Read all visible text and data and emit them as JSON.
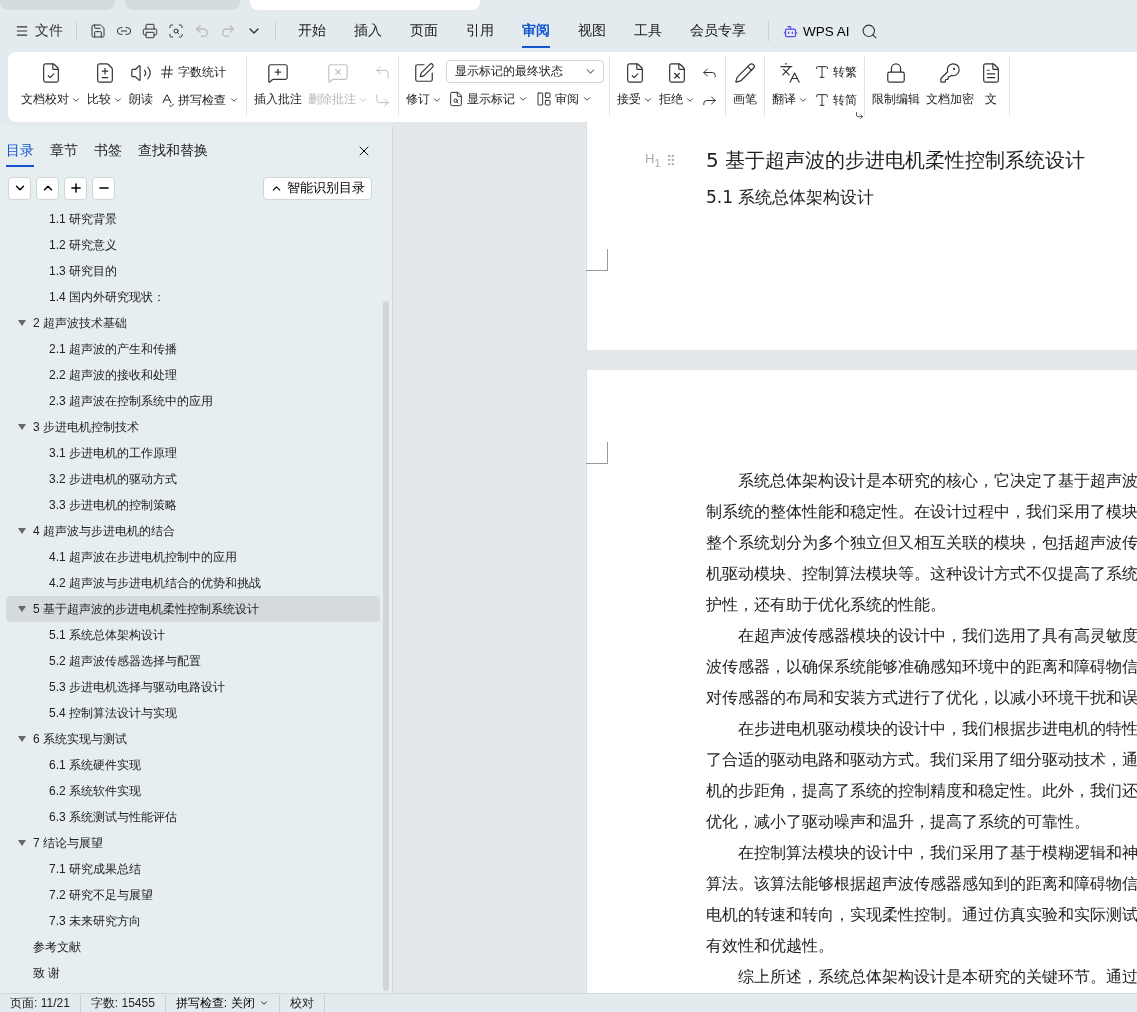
{
  "browser_tabs": [
    {
      "selected": false
    },
    {
      "selected": false
    },
    {
      "selected": true
    }
  ],
  "menu": {
    "file_label": "文件",
    "tabs": [
      {
        "label": "开始",
        "selected": false
      },
      {
        "label": "插入",
        "selected": false
      },
      {
        "label": "页面",
        "selected": false
      },
      {
        "label": "引用",
        "selected": false
      },
      {
        "label": "审阅",
        "selected": true
      },
      {
        "label": "视图",
        "selected": false
      },
      {
        "label": "工具",
        "selected": false
      },
      {
        "label": "会员专享",
        "selected": false
      }
    ],
    "ai_label": "WPS AI"
  },
  "ribbon": {
    "groups": [
      {
        "items": [
          {
            "kind": "large",
            "label": "文档校对",
            "caret": true,
            "disabled": false
          },
          {
            "kind": "large",
            "label": "比较",
            "caret": true,
            "disabled": false
          },
          {
            "kind": "large",
            "label": "朗读",
            "caret": false,
            "disabled": false
          },
          {
            "kind": "stack",
            "items": [
              {
                "kind": "small",
                "label": "字数统计",
                "caret": false,
                "disabled": false
              },
              {
                "kind": "small",
                "label": "拼写检查",
                "caret": true,
                "disabled": false
              }
            ]
          }
        ]
      },
      {
        "items": [
          {
            "kind": "large",
            "label": "插入批注",
            "caret": false,
            "disabled": false
          },
          {
            "kind": "large",
            "label": "删除批注",
            "caret": true,
            "disabled": true
          },
          {
            "kind": "stack",
            "items": [
              {
                "kind": "icon",
                "disabled": true
              },
              {
                "kind": "icon",
                "disabled": true
              }
            ]
          }
        ]
      },
      {
        "items": [
          {
            "kind": "large",
            "label": "修订",
            "caret": true,
            "disabled": false
          },
          {
            "kind": "stack",
            "items": [
              {
                "kind": "select",
                "value": "显示标记的最终状态"
              },
              {
                "kind": "row",
                "items": [
                  {
                    "kind": "small",
                    "label": "显示标记",
                    "caret": true,
                    "disabled": false
                  },
                  {
                    "kind": "small",
                    "label": "审阅",
                    "caret": true,
                    "disabled": false
                  }
                ]
              }
            ]
          }
        ]
      },
      {
        "items": [
          {
            "kind": "large",
            "label": "接受",
            "caret": true,
            "disabled": false
          },
          {
            "kind": "large",
            "label": "拒绝",
            "caret": true,
            "disabled": false
          },
          {
            "kind": "stack",
            "items": [
              {
                "kind": "icon",
                "disabled": false
              },
              {
                "kind": "icon",
                "disabled": false
              }
            ]
          }
        ]
      },
      {
        "items": [
          {
            "kind": "large",
            "label": "画笔",
            "caret": false,
            "disabled": false
          }
        ]
      },
      {
        "launcher": true,
        "items": [
          {
            "kind": "large",
            "label": "翻译",
            "caret": true,
            "disabled": false
          },
          {
            "kind": "stack",
            "items": [
              {
                "kind": "small",
                "label": "转繁",
                "caret": false,
                "disabled": false
              },
              {
                "kind": "small",
                "label": "转简",
                "caret": false,
                "disabled": false
              }
            ]
          }
        ]
      },
      {
        "items": [
          {
            "kind": "large",
            "label": "限制编辑",
            "caret": false,
            "disabled": false
          },
          {
            "kind": "large",
            "label": "文档加密",
            "caret": false,
            "disabled": false
          },
          {
            "kind": "large",
            "label": "文",
            "caret": false,
            "disabled": false
          }
        ]
      }
    ]
  },
  "nav_panel": {
    "tabs": [
      {
        "label": "目录",
        "selected": true
      },
      {
        "label": "章节",
        "selected": false
      },
      {
        "label": "书签",
        "selected": false
      },
      {
        "label": "查找和替换",
        "selected": false
      }
    ],
    "smart_button": "智能识别目录",
    "continued": [
      {
        "label": "1.1  研究背景",
        "selected": false
      },
      {
        "label": "1.2  研究意义",
        "selected": false
      },
      {
        "label": "1.3  研究目的",
        "selected": false
      },
      {
        "label": "1.4 国内外研究现状：",
        "selected": false
      }
    ],
    "items": [
      {
        "label": "2  超声波技术基础",
        "selected": false,
        "expanded": true,
        "children": [
          {
            "label": "2.1  超声波的产生和传播",
            "selected": false
          },
          {
            "label": "2.2  超声波的接收和处理",
            "selected": false
          },
          {
            "label": "2.3  超声波在控制系统中的应用",
            "selected": false
          }
        ]
      },
      {
        "label": "3  步进电机控制技术",
        "selected": false,
        "expanded": true,
        "children": [
          {
            "label": "3.1  步进电机的工作原理",
            "selected": false
          },
          {
            "label": "3.2  步进电机的驱动方式",
            "selected": false
          },
          {
            "label": "3.3  步进电机的控制策略",
            "selected": false
          }
        ]
      },
      {
        "label": "4  超声波与步进电机的结合",
        "selected": false,
        "expanded": true,
        "children": [
          {
            "label": "4.1  超声波在步进电机控制中的应用",
            "selected": false
          },
          {
            "label": "4.2  超声波与步进电机结合的优势和挑战",
            "selected": false
          }
        ]
      },
      {
        "label": "5  基于超声波的步进电机柔性控制系统设计",
        "selected": true,
        "expanded": true,
        "children": [
          {
            "label": "5.1  系统总体架构设计",
            "selected": false
          },
          {
            "label": "5.2  超声波传感器选择与配置",
            "selected": false
          },
          {
            "label": "5.3  步进电机选择与驱动电路设计",
            "selected": false
          },
          {
            "label": "5.4  控制算法设计与实现",
            "selected": false
          }
        ]
      },
      {
        "label": "6  系统实现与测试",
        "selected": false,
        "expanded": true,
        "children": [
          {
            "label": "6.1  系统硬件实现",
            "selected": false
          },
          {
            "label": "6.2  系统软件实现",
            "selected": false
          },
          {
            "label": "6.3  系统测试与性能评估",
            "selected": false
          }
        ]
      },
      {
        "label": "7  结论与展望",
        "selected": false,
        "expanded": true,
        "children": [
          {
            "label": "7.1  研究成果总结",
            "selected": false
          },
          {
            "label": "7.2  研究不足与展望",
            "selected": false
          },
          {
            "label": "7.3  未来研究方向",
            "selected": false
          }
        ]
      },
      {
        "label": "参考文献",
        "selected": false
      },
      {
        "label": "致  谢",
        "selected": false
      }
    ]
  },
  "document": {
    "heading_marker": "H$_{1}$",
    "heading": "5  基于超声波的步进电机柔性控制系统设计",
    "subheading": "5.1  系统总体架构设计",
    "paragraphs": [
      {
        "lines": [
          "系统总体架构设计是本研究的核心，它决定了基于超声波",
          "制系统的整体性能和稳定性。在设计过程中，我们采用了模块",
          "整个系统划分为多个独立但又相互关联的模块，包括超声波传",
          "机驱动模块、控制算法模块等。这种设计方式不仅提高了系统",
          "护性，还有助于优化系统的性能。"
        ]
      },
      {
        "lines": [
          "在超声波传感器模块的设计中，我们选用了具有高灵敏度",
          "波传感器，以确保系统能够准确感知环境中的距离和障碍物信",
          "对传感器的布局和安装方式进行了优化，以减小环境干扰和误"
        ]
      },
      {
        "lines": [
          "在步进电机驱动模块的设计中，我们根据步进电机的特性",
          "了合适的驱动电路和驱动方式。我们采用了细分驱动技术，通",
          "机的步距角，提高了系统的控制精度和稳定性。此外，我们还",
          "优化，减小了驱动噪声和温升，提高了系统的可靠性。"
        ]
      },
      {
        "lines": [
          "在控制算法模块的设计中，我们采用了基于模糊逻辑和神",
          "算法。该算法能够根据超声波传感器感知到的距离和障碍物信",
          "电机的转速和转向，实现柔性控制。通过仿真实验和实际测试",
          "有效性和优越性。"
        ]
      },
      {
        "lines": [
          "综上所述，系统总体架构设计是本研究的关键环节。通过"
        ]
      }
    ]
  },
  "status_bar": [
    {
      "kind": "text",
      "label": "页面: 11/21"
    },
    {
      "kind": "text",
      "label": "字数: 15455"
    },
    {
      "kind": "menu",
      "label": "拼写检查: 关闭"
    },
    {
      "kind": "text",
      "label": "校对"
    }
  ]
}
